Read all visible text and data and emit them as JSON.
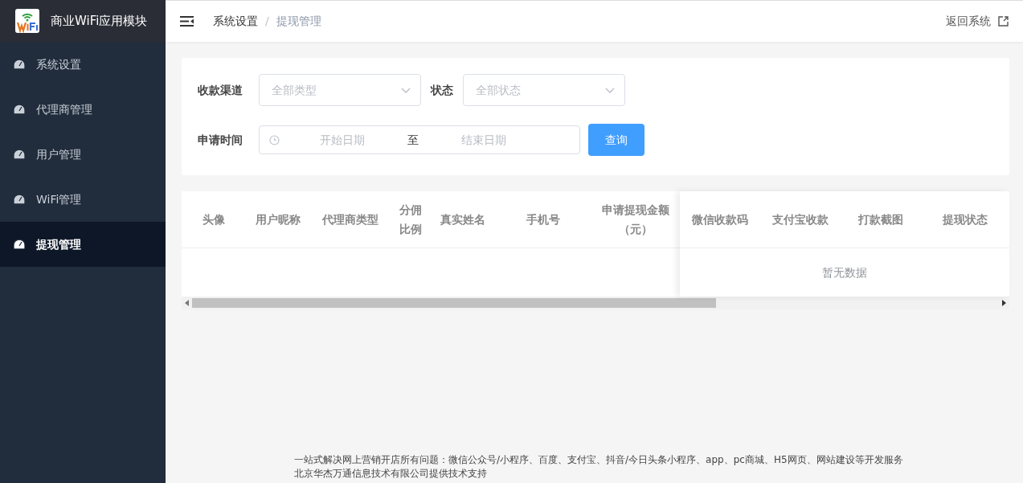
{
  "sidebar": {
    "app_title": "商业WiFi应用模块",
    "items": [
      {
        "label": "系统设置",
        "selected": false
      },
      {
        "label": "代理商管理",
        "selected": false
      },
      {
        "label": "用户管理",
        "selected": false
      },
      {
        "label": "WiFi管理",
        "selected": false
      },
      {
        "label": "提现管理",
        "selected": true
      }
    ]
  },
  "header": {
    "breadcrumb": [
      {
        "label": "系统设置",
        "current": false
      },
      {
        "label": "提现管理",
        "current": true
      }
    ],
    "breadcrumb_separator": "/",
    "return_link": "返回系统"
  },
  "filters": {
    "channel": {
      "label": "收款渠道",
      "placeholder": "全部类型"
    },
    "status": {
      "label": "状态",
      "placeholder": "全部状态"
    },
    "date_range": {
      "label": "申请时间",
      "start_placeholder": "开始日期",
      "separator": "至",
      "end_placeholder": "结束日期"
    },
    "query_button": "查询"
  },
  "table": {
    "columns": [
      "头像",
      "用户昵称",
      "代理商类型",
      "分佣比例",
      "真实姓名",
      "手机号",
      "申请提现金额（元）"
    ],
    "fixed_columns": [
      "微信收款码",
      "支付宝收款",
      "打款截图",
      "提现状态"
    ],
    "empty_text": "暂无数据"
  },
  "footer": [
    "一站式解决网上营销开店所有问题：微信公众号/小程序、百度、支付宝、抖音/今日头条小程序、app、pc商城、H5网页、网站建设等开发服务",
    "北京华杰万通信息技术有限公司提供技术支持"
  ]
}
